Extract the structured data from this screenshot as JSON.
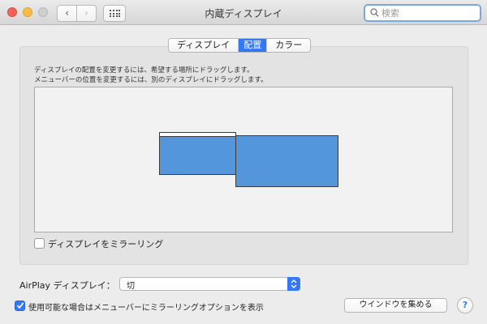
{
  "window": {
    "title": "内蔵ディスプレイ"
  },
  "toolbar": {
    "back_icon": "chevron-left-icon",
    "forward_icon": "chevron-right-icon",
    "grid_icon": "show-all-grid-icon",
    "back_glyph": "‹",
    "forward_glyph": "›"
  },
  "search": {
    "placeholder": "検索",
    "value": ""
  },
  "tabs": [
    {
      "label": "ディスプレイ",
      "active": false
    },
    {
      "label": "配置",
      "active": true
    },
    {
      "label": "カラー",
      "active": false
    }
  ],
  "arrangement": {
    "instruction_1": "ディスプレイの配置を変更するには、希望する場所にドラッグします。",
    "instruction_2": "メニューバーの位置を変更するには、別のディスプレイにドラッグします。"
  },
  "mirror": {
    "label": "ディスプレイをミラーリング",
    "checked": false
  },
  "airplay": {
    "label": "AirPlay ディスプレイ：",
    "selected": "切"
  },
  "menu_option": {
    "label": "使用可能な場合はメニューバーにミラーリングオプションを表示",
    "checked": true
  },
  "buttons": {
    "gather_windows": "ウインドウを集める",
    "help": "?"
  },
  "colors": {
    "accent": "#3478f6",
    "display_fill": "#5396dc"
  }
}
